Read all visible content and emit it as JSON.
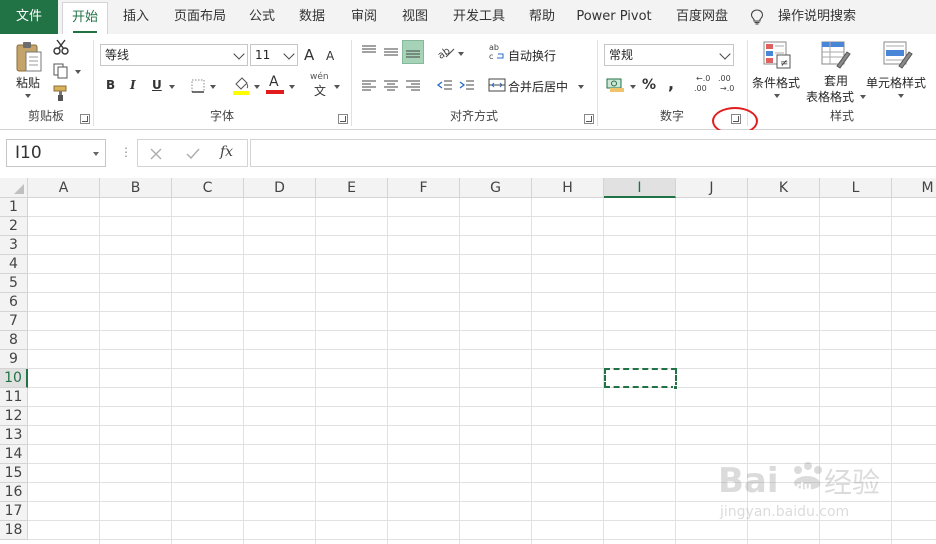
{
  "tabs": {
    "file": "文件",
    "items": [
      "开始",
      "插入",
      "页面布局",
      "公式",
      "数据",
      "审阅",
      "视图",
      "开发工具",
      "帮助",
      "Power Pivot",
      "百度网盘"
    ],
    "tell_me": "操作说明搜索"
  },
  "ribbon": {
    "clipboard": {
      "paste": "粘贴",
      "label": "剪贴板"
    },
    "font": {
      "name": "等线",
      "size": "11",
      "grow": "A",
      "shrink": "A",
      "bold": "B",
      "italic": "I",
      "underline": "U",
      "color_letter": "A",
      "phonetic": "wén",
      "phonetic_char": "文",
      "label": "字体"
    },
    "alignment": {
      "wrap_text": "自动换行",
      "merge_center": "合并后居中",
      "label": "对齐方式"
    },
    "number": {
      "format": "常规",
      "percent": "%",
      "comma": ",",
      "inc_decimal": ".00",
      "dec_decimal": ".00",
      "label": "数字"
    },
    "styles": {
      "conditional": "条件格式",
      "table_format_1": "套用",
      "table_format_2": "表格格式",
      "cell_styles": "单元格样式",
      "label": "样式"
    }
  },
  "formula_bar": {
    "name_box": "I10",
    "fx": "fx",
    "formula": ""
  },
  "grid": {
    "columns": [
      "A",
      "B",
      "C",
      "D",
      "E",
      "F",
      "G",
      "H",
      "I",
      "J",
      "K",
      "L",
      "M"
    ],
    "rows": [
      "1",
      "2",
      "3",
      "4",
      "5",
      "6",
      "7",
      "8",
      "9",
      "10",
      "11",
      "12",
      "13",
      "14",
      "15",
      "16",
      "17",
      "18"
    ],
    "selected_column": "I",
    "selected_row": "10"
  },
  "watermark": {
    "brand": "Bai",
    "brand_du": "du",
    "brand_cn": "经验",
    "url": "jingyan.baidu.com"
  },
  "colors": {
    "accent": "#217346",
    "highlight": "#e21c1c"
  }
}
